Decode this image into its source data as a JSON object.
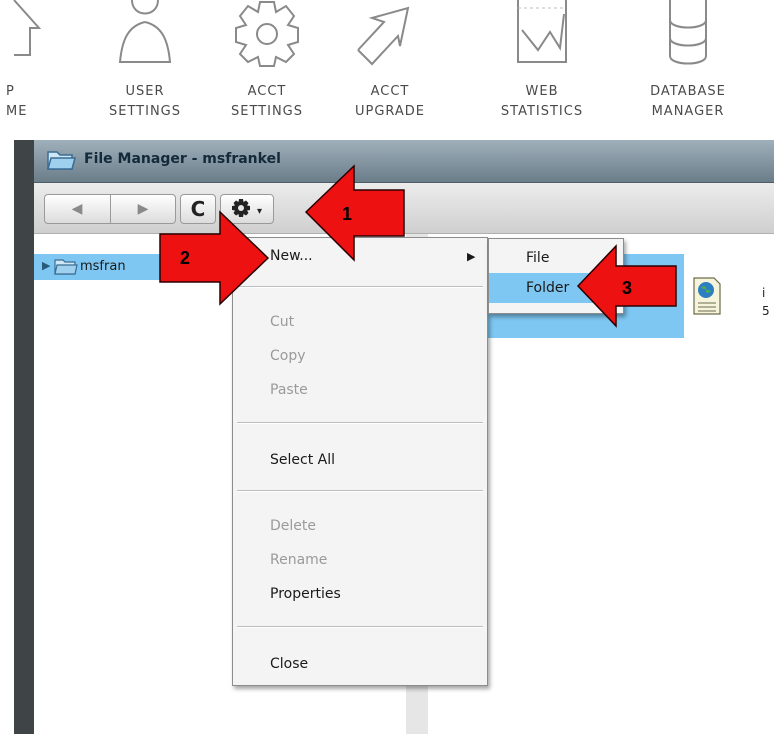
{
  "toolbar_icons": [
    {
      "icon": "home-icon",
      "label": "P\nME"
    },
    {
      "icon": "user-icon",
      "label": "USER\nSETTINGS"
    },
    {
      "icon": "gear-icon",
      "label": "ACCT\nSETTINGS"
    },
    {
      "icon": "upgrade-arrow-icon",
      "label": "ACCT\nUPGRADE"
    },
    {
      "icon": "statistics-chart-icon",
      "label": "WEB\nSTATISTICS"
    },
    {
      "icon": "database-icon",
      "label": "DATABASE\nMANAGER"
    }
  ],
  "window": {
    "title": "File Manager - msfrankel",
    "nav_back": "◀",
    "nav_forward": "▶",
    "refresh": "C",
    "gear_caret": "▾"
  },
  "tree": {
    "item_label": "msfran"
  },
  "content": {
    "file_label_line1": "i",
    "file_label_line2": "5"
  },
  "menu": {
    "new_label": "New...",
    "cut_label": "Cut",
    "copy_label": "Copy",
    "paste_label": "Paste",
    "select_all_label": "Select All",
    "delete_label": "Delete",
    "rename_label": "Rename",
    "properties_label": "Properties",
    "close_label": "Close"
  },
  "submenu": {
    "file_label": "File",
    "folder_label": "Folder"
  },
  "annotations": {
    "step1": "1",
    "step2": "2",
    "step3": "3"
  },
  "colors": {
    "arrow_red": "#ee1111",
    "selection_blue": "#7ec7f2",
    "titlebar": "#7d8e99"
  }
}
